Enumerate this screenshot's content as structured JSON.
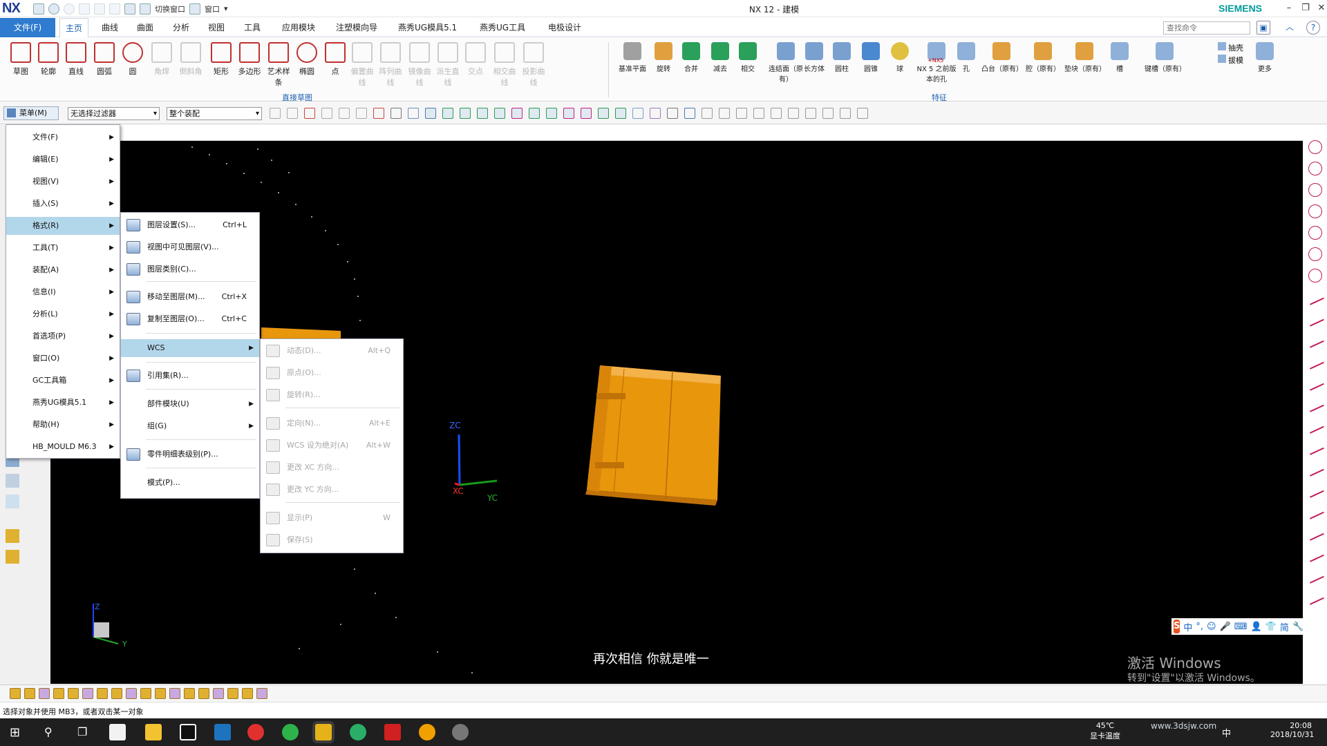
{
  "app": {
    "logo": "NX",
    "title": "NX 12 - 建模",
    "brand": "SIEMENS",
    "quick_access": {
      "switch_window": "切换窗口",
      "window": "窗口"
    }
  },
  "ribbon_tabs": [
    "文件(F)",
    "主页",
    "曲线",
    "曲面",
    "分析",
    "视图",
    "工具",
    "应用模块",
    "注塑模向导",
    "燕秀UG模具5.1",
    "燕秀UG工具",
    "电极设计"
  ],
  "search": {
    "placeholder": "查找命令"
  },
  "ribbon": {
    "sketch_buttons": [
      "草图",
      "轮廓",
      "直线",
      "圆弧",
      "圆",
      "角焊",
      "倒斜角",
      "矩形",
      "多边形",
      "艺术样条",
      "椭圆",
      "点",
      "偏置曲线",
      "阵列曲线",
      "镜像曲线",
      "派生直线",
      "交点",
      "相交曲线",
      "投影曲线"
    ],
    "sketch_group": "直接草图",
    "feature_buttons": [
      "基准平面",
      "旋转",
      "合并",
      "减去",
      "相交",
      "连结面（原有）",
      "长方体",
      "圆柱",
      "圆锥",
      "球",
      "NX 5 之前版本的孔",
      "孔",
      "凸台（原有）",
      "腔（原有）",
      "垫块（原有）",
      "槽",
      "键槽（原有）",
      "更多"
    ],
    "feature_small": [
      "抽壳",
      "拔模"
    ],
    "nx5_badge": "+NX5",
    "feature_group": "特征"
  },
  "toolbar": {
    "menu_label": "菜单(M)",
    "filter_value": "无选择过滤器",
    "assembly_value": "整个装配"
  },
  "main_menu": [
    {
      "label": "文件(F)"
    },
    {
      "label": "编辑(E)"
    },
    {
      "label": "视图(V)"
    },
    {
      "label": "插入(S)"
    },
    {
      "label": "格式(R)"
    },
    {
      "label": "工具(T)"
    },
    {
      "label": "装配(A)"
    },
    {
      "label": "信息(I)"
    },
    {
      "label": "分析(L)"
    },
    {
      "label": "首选项(P)"
    },
    {
      "label": "窗口(O)"
    },
    {
      "label": "GC工具箱"
    },
    {
      "label": "燕秀UG模具5.1"
    },
    {
      "label": "帮助(H)"
    },
    {
      "label": "HB_MOULD M6.3"
    }
  ],
  "format_menu": [
    {
      "label": "图层设置(S)...",
      "shortcut": "Ctrl+L"
    },
    {
      "label": "视图中可见图层(V)...",
      "shortcut": ""
    },
    {
      "label": "图层类别(C)...",
      "shortcut": ""
    },
    {
      "label": "移动至图层(M)...",
      "shortcut": "Ctrl+X"
    },
    {
      "label": "复制至图层(O)...",
      "shortcut": "Ctrl+C"
    },
    {
      "label": "WCS",
      "shortcut": ""
    },
    {
      "label": "引用集(R)...",
      "shortcut": ""
    },
    {
      "label": "部件模块(U)",
      "shortcut": ""
    },
    {
      "label": "组(G)",
      "shortcut": ""
    },
    {
      "label": "零件明细表级别(P)...",
      "shortcut": ""
    },
    {
      "label": "模式(P)...",
      "shortcut": ""
    }
  ],
  "wcs_menu": [
    {
      "label": "动态(D)...",
      "shortcut": "Alt+Q"
    },
    {
      "label": "原点(O)...",
      "shortcut": ""
    },
    {
      "label": "旋转(R)...",
      "shortcut": ""
    },
    {
      "label": "定向(N)...",
      "shortcut": "Alt+E"
    },
    {
      "label": "WCS 设为绝对(A)",
      "shortcut": "Alt+W"
    },
    {
      "label": "更改 XC 方向...",
      "shortcut": ""
    },
    {
      "label": "更改 YC 方向...",
      "shortcut": ""
    },
    {
      "label": "显示(P)",
      "shortcut": "W"
    },
    {
      "label": "保存(S)",
      "shortcut": ""
    }
  ],
  "viewport": {
    "axis_zc": "ZC",
    "axis_xc": "XC",
    "axis_yc": "YC",
    "triad_z": "Z",
    "triad_y": "Y",
    "caption": "再次相信 你就是唯一",
    "activation_title": "激活 Windows",
    "activation_sub": "转到\"设置\"以激活 Windows。",
    "ime": [
      "中",
      "°,",
      "☺",
      "🎤",
      "⌨",
      "👤",
      "👕",
      "简",
      "🔧"
    ]
  },
  "status": {
    "text": "选择对象并使用 MB3，或者双击某一对象"
  },
  "taskbar": {
    "temperature": "45℃",
    "temperature_label": "显卡温度",
    "ime": "中",
    "time": "20:08",
    "date": "2018/10/31",
    "site": "www.3dsjw.com"
  },
  "colors": {
    "accent": "#2e7bcf",
    "viewport_bg": "#000000",
    "part": "#e8960c",
    "menu_highlight": "#b3d7ea"
  }
}
